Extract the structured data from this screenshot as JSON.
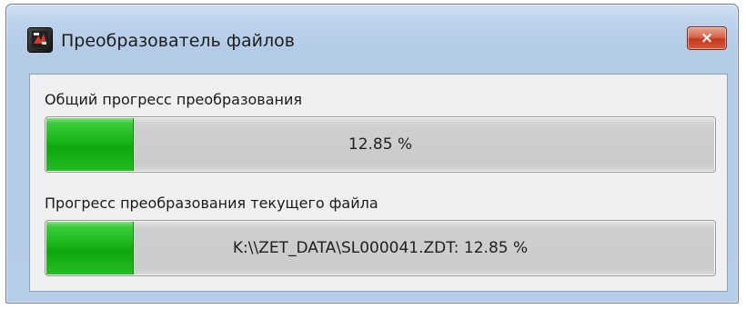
{
  "window": {
    "title": "Преобразователь файлов",
    "close_label": "×",
    "app_icon": "converter-app-icon"
  },
  "overall": {
    "label": "Общий прогресс преобразования",
    "text": "12.85 %",
    "progress_fraction": 0.1285
  },
  "current_file": {
    "label": "Прогресс преобразования текущего файла",
    "text": "K:\\\\ZET_DATA\\SL000041.ZDT: 12.85 %",
    "progress_fraction": 0.1285
  },
  "colors": {
    "progress_fill": "#18b418",
    "close_button": "#c7391d",
    "titlebar": "#bdd3ec"
  }
}
